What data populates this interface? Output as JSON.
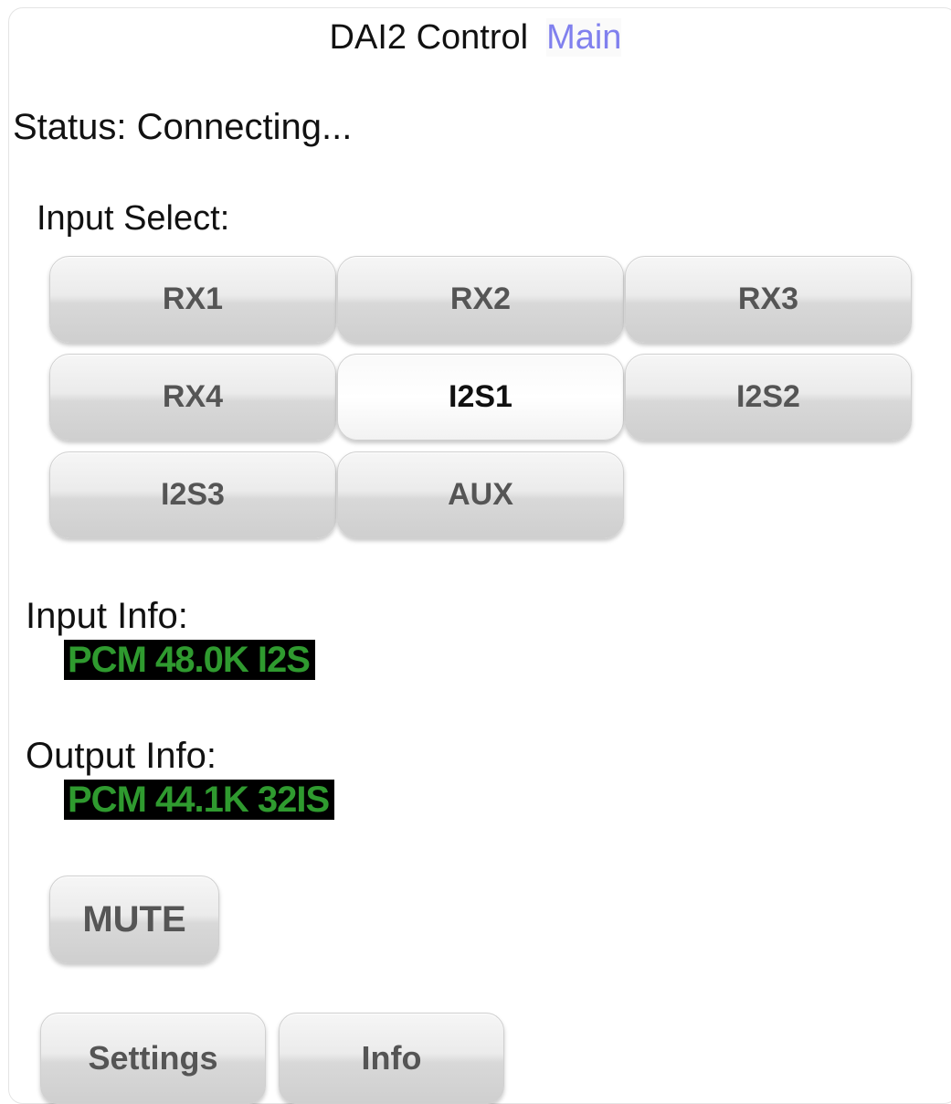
{
  "header": {
    "title": "DAI2 Control",
    "main_link": "Main"
  },
  "status": {
    "text": "Status: Connecting..."
  },
  "input_select": {
    "label": "Input Select:",
    "selected": "I2S1",
    "buttons": [
      {
        "label": "RX1"
      },
      {
        "label": "RX2"
      },
      {
        "label": "RX3"
      },
      {
        "label": "RX4"
      },
      {
        "label": "I2S1"
      },
      {
        "label": "I2S2"
      },
      {
        "label": "I2S3"
      },
      {
        "label": "AUX"
      }
    ]
  },
  "input_info": {
    "label": "Input Info:",
    "value": "PCM 48.0K I2S"
  },
  "output_info": {
    "label": "Output Info:",
    "value": "PCM 44.1K 32IS"
  },
  "mute": {
    "label": "MUTE"
  },
  "footer": {
    "settings_label": "Settings",
    "info_label": "Info"
  },
  "colors": {
    "lcd_background": "#000000",
    "lcd_text": "#2f9a2f",
    "link": "#8080ee"
  }
}
